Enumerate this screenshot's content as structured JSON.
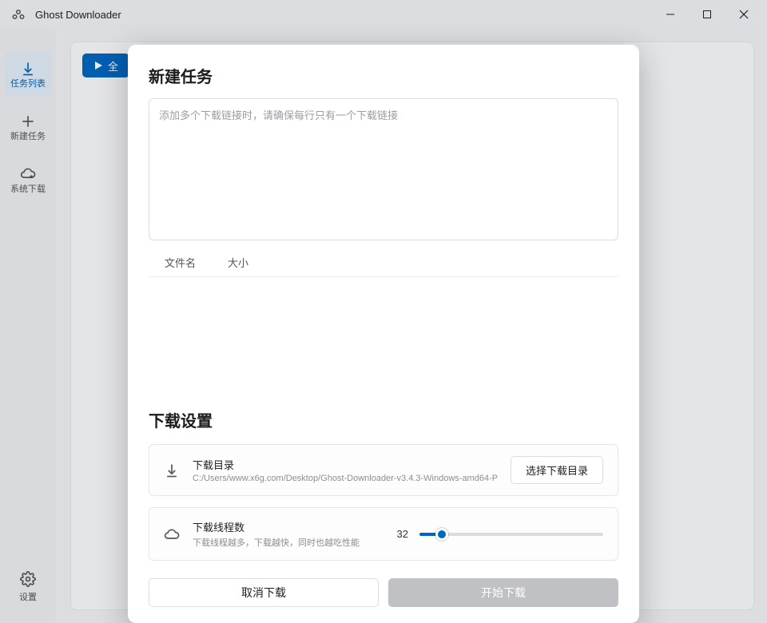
{
  "app": {
    "title": "Ghost Downloader"
  },
  "sidebar": {
    "items": [
      {
        "label": "任务列表"
      },
      {
        "label": "新建任务"
      },
      {
        "label": "系统下载"
      }
    ],
    "settings_label": "设置"
  },
  "toolbar": {
    "start_all_label": "全"
  },
  "dialog": {
    "title": "新建任务",
    "url_placeholder": "添加多个下载链接时，请确保每行只有一个下载链接",
    "table": {
      "col_name": "文件名",
      "col_size": "大小"
    },
    "settings_title": "下载设置",
    "dir": {
      "label": "下载目录",
      "path": "C:/Users/www.x6g.com/Desktop/Ghost-Downloader-v3.4.3-Windows-amd64-P",
      "choose_label": "选择下载目录"
    },
    "threads": {
      "label": "下载线程数",
      "desc": "下载线程越多，下载越快，同时也越吃性能",
      "value": "32",
      "percent": 12
    },
    "cancel_label": "取消下载",
    "start_label": "开始下载"
  }
}
